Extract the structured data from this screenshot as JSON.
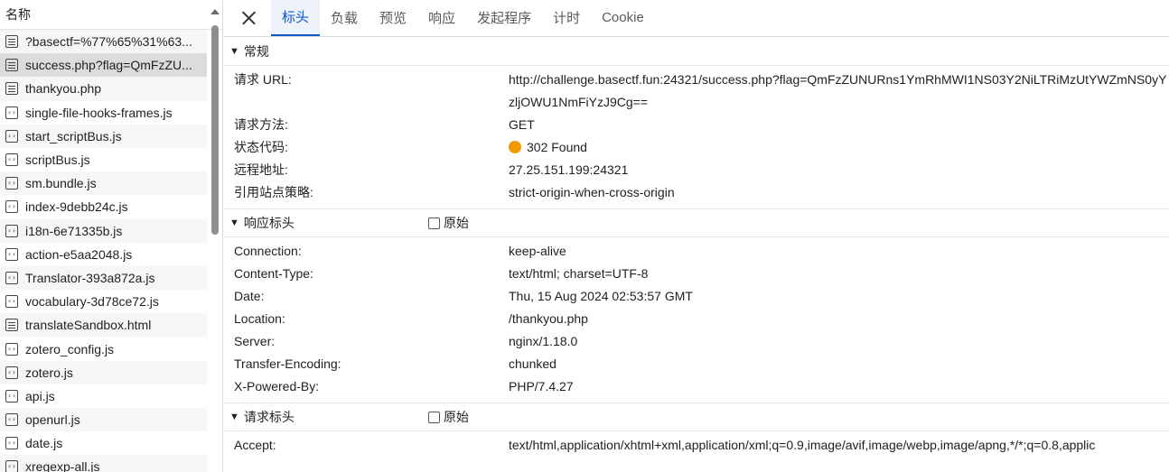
{
  "left": {
    "header": "名称",
    "requests": [
      {
        "name": "?basectf=%77%65%31%63...",
        "icon": "document-icon",
        "type": "doc"
      },
      {
        "name": "success.php?flag=QmFzZU...",
        "icon": "document-icon",
        "type": "doc",
        "selected": true
      },
      {
        "name": "thankyou.php",
        "icon": "document-icon",
        "type": "doc"
      },
      {
        "name": "single-file-hooks-frames.js",
        "icon": "script-icon",
        "type": "js"
      },
      {
        "name": "start_scriptBus.js",
        "icon": "script-icon",
        "type": "js"
      },
      {
        "name": "scriptBus.js",
        "icon": "script-icon",
        "type": "js"
      },
      {
        "name": "sm.bundle.js",
        "icon": "script-icon",
        "type": "js"
      },
      {
        "name": "index-9debb24c.js",
        "icon": "script-icon",
        "type": "js"
      },
      {
        "name": "i18n-6e71335b.js",
        "icon": "script-icon",
        "type": "js"
      },
      {
        "name": "action-e5aa2048.js",
        "icon": "script-icon",
        "type": "js"
      },
      {
        "name": "Translator-393a872a.js",
        "icon": "script-icon",
        "type": "js"
      },
      {
        "name": "vocabulary-3d78ce72.js",
        "icon": "script-icon",
        "type": "js"
      },
      {
        "name": "translateSandbox.html",
        "icon": "document-icon",
        "type": "doc"
      },
      {
        "name": "zotero_config.js",
        "icon": "script-icon",
        "type": "js"
      },
      {
        "name": "zotero.js",
        "icon": "script-icon",
        "type": "js"
      },
      {
        "name": "api.js",
        "icon": "script-icon",
        "type": "js"
      },
      {
        "name": "openurl.js",
        "icon": "script-icon",
        "type": "js"
      },
      {
        "name": "date.js",
        "icon": "script-icon",
        "type": "js"
      },
      {
        "name": "xregexp-all.js",
        "icon": "script-icon",
        "type": "js"
      }
    ]
  },
  "tabs": [
    "标头",
    "负载",
    "预览",
    "响应",
    "发起程序",
    "计时",
    "Cookie"
  ],
  "active_tab": "标头",
  "general": {
    "title": "常规",
    "rows": [
      {
        "key": "请求 URL:",
        "value": "http://challenge.basectf.fun:24321/success.php?flag=QmFzZUNURns1YmRhMWI1NS03Y2NiLTRiMzUtYWZmNS0yYzljOWU1NmFiYzJ9Cg=="
      },
      {
        "key": "请求方法:",
        "value": "GET"
      },
      {
        "key": "状态代码:",
        "value": "302 Found",
        "status_color": "#f29900"
      },
      {
        "key": "远程地址:",
        "value": "27.25.151.199:24321"
      },
      {
        "key": "引用站点策略:",
        "value": "strict-origin-when-cross-origin"
      }
    ]
  },
  "response_headers": {
    "title": "响应标头",
    "raw_label": "原始",
    "rows": [
      {
        "key": "Connection:",
        "value": "keep-alive"
      },
      {
        "key": "Content-Type:",
        "value": "text/html; charset=UTF-8"
      },
      {
        "key": "Date:",
        "value": "Thu, 15 Aug 2024 02:53:57 GMT"
      },
      {
        "key": "Location:",
        "value": "/thankyou.php"
      },
      {
        "key": "Server:",
        "value": "nginx/1.18.0"
      },
      {
        "key": "Transfer-Encoding:",
        "value": "chunked"
      },
      {
        "key": "X-Powered-By:",
        "value": "PHP/7.4.27"
      }
    ]
  },
  "request_headers": {
    "title": "请求标头",
    "raw_label": "原始",
    "rows": [
      {
        "key": "Accept:",
        "value": "text/html,application/xhtml+xml,application/xml;q=0.9,image/avif,image/webp,image/apng,*/*;q=0.8,applic"
      }
    ]
  },
  "colors": {
    "accent": "#0b57d0",
    "status_redirect": "#f29900"
  }
}
